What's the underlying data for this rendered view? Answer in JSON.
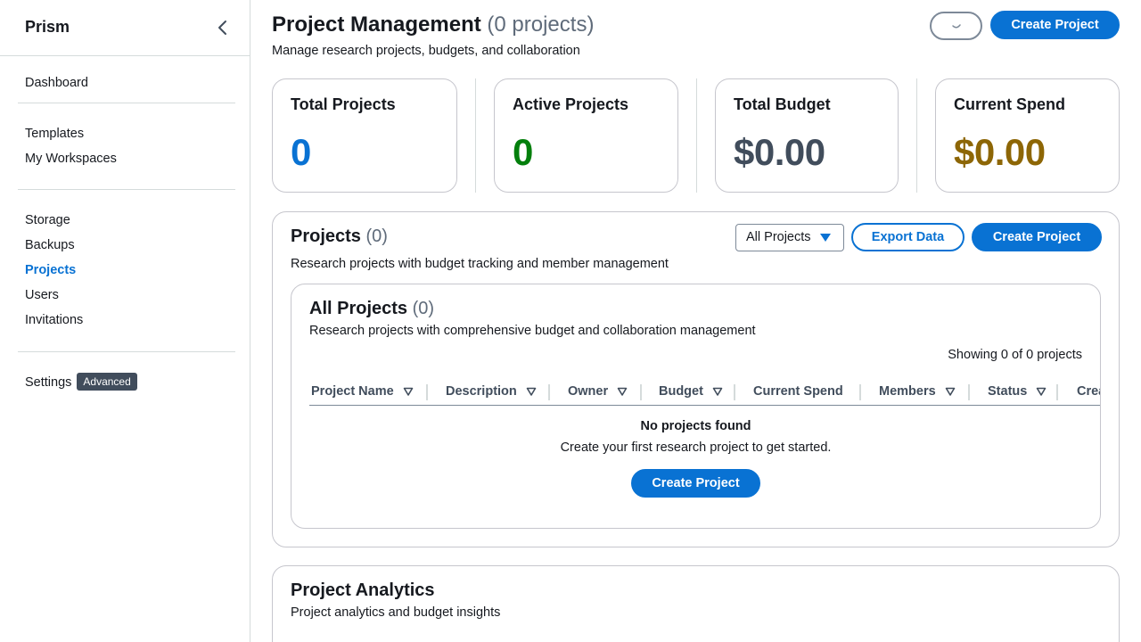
{
  "sidebar": {
    "title": "Prism",
    "groups": [
      [
        {
          "label": "Dashboard"
        }
      ],
      [
        {
          "label": "Templates"
        },
        {
          "label": "My Workspaces"
        }
      ],
      [
        {
          "label": "Storage"
        },
        {
          "label": "Backups"
        },
        {
          "label": "Projects"
        },
        {
          "label": "Users"
        },
        {
          "label": "Invitations"
        }
      ],
      [
        {
          "label": "Settings",
          "badge": "Advanced"
        }
      ]
    ]
  },
  "header": {
    "title": "Project Management",
    "count": "(0 projects)",
    "subtitle": "Manage research projects, budgets, and collaboration",
    "create_label": "Create Project"
  },
  "stats": [
    {
      "label": "Total Projects",
      "value": "0",
      "color": "#0972d3"
    },
    {
      "label": "Active Projects",
      "value": "0",
      "color": "#037f0c"
    },
    {
      "label": "Total Budget",
      "value": "$0.00",
      "color": "#414d5c"
    },
    {
      "label": "Current Spend",
      "value": "$0.00",
      "color": "#8d6605"
    }
  ],
  "projects": {
    "title": "Projects",
    "count": "(0)",
    "description": "Research projects with budget tracking and member management",
    "filter": "All Projects",
    "export_label": "Export Data",
    "create_label": "Create Project",
    "table": {
      "title": "All Projects",
      "count": "(0)",
      "description": "Research projects with comprehensive budget and collaboration management",
      "showing": "Showing 0 of 0 projects",
      "columns": [
        "Project Name",
        "Description",
        "Owner",
        "Budget",
        "Current Spend",
        "Members",
        "Status",
        "Crea"
      ],
      "empty_title": "No projects found",
      "empty_desc": "Create your first research project to get started.",
      "empty_button": "Create Project"
    }
  },
  "analytics": {
    "title": "Project Analytics",
    "description": "Project analytics and budget insights"
  },
  "colors": {
    "accent": "#0972d3",
    "active_green": "#037f0c",
    "spend_gold": "#8d6605"
  }
}
